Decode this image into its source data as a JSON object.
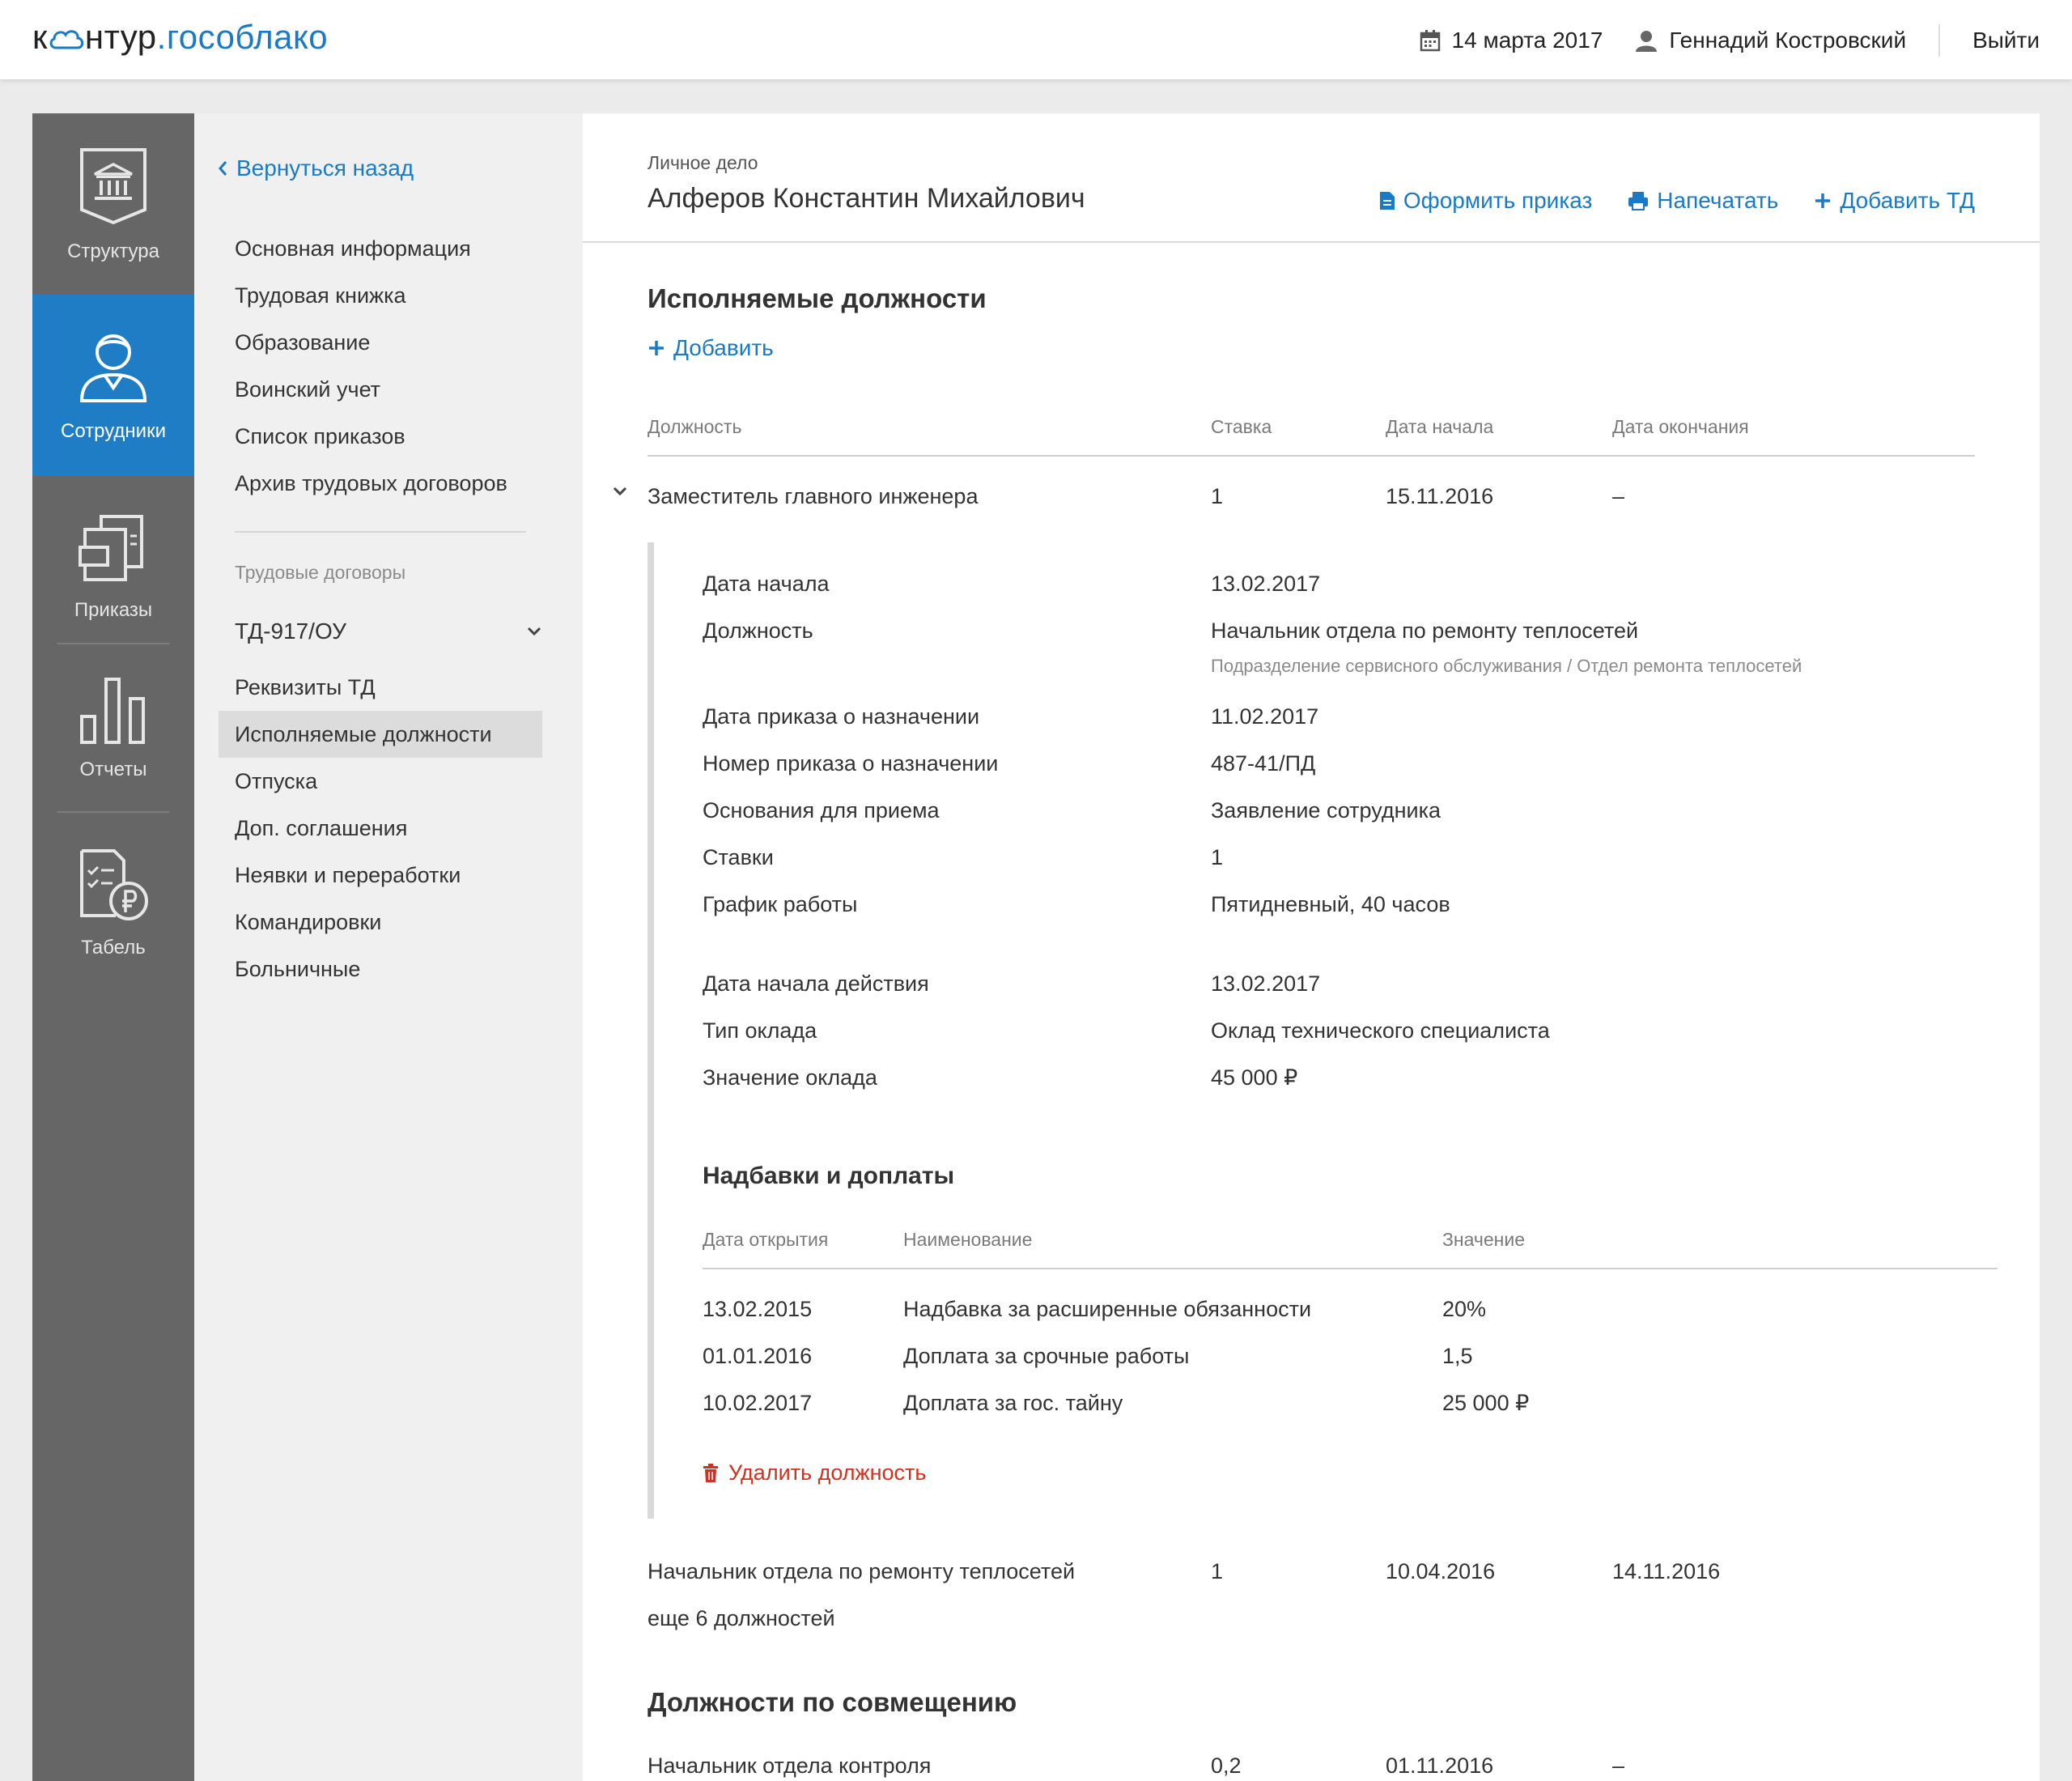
{
  "header": {
    "logo_a": "к",
    "logo_b": "нтур",
    "logo_c": ".гособлако",
    "date": "14 марта 2017",
    "user": "Геннадий Костровский",
    "logout": "Выйти"
  },
  "rail": {
    "items": [
      {
        "label": "Структура",
        "icon": "building-icon"
      },
      {
        "label": "Сотрудники",
        "icon": "employee-icon"
      },
      {
        "label": "Приказы",
        "icon": "documents-icon"
      },
      {
        "label": "Отчеты",
        "icon": "bar-chart-icon"
      },
      {
        "label": "Табель",
        "icon": "timesheet-icon"
      }
    ]
  },
  "subnav": {
    "back": "Вернуться назад",
    "links": [
      "Основная информация",
      "Трудовая книжка",
      "Образование",
      "Воинский учет",
      "Список приказов",
      "Архив трудовых договоров"
    ],
    "caption": "Трудовые договоры",
    "contract": "ТД-917/ОУ",
    "contract_links": [
      "Реквизиты ТД",
      "Исполняемые должности",
      "Отпуска",
      "Доп. соглашения",
      "Неявки и переработки",
      "Командировки",
      "Больничные"
    ]
  },
  "main": {
    "crumb": "Личное дело",
    "person": "Алферов Константин Михайлович",
    "actions": [
      "Оформить приказ",
      "Напечатать",
      "Добавить ТД"
    ],
    "section_title": "Исполняемые должности",
    "add": "Добавить",
    "columns": [
      "Должность",
      "Ставка",
      "Дата начала",
      "Дата окончания"
    ],
    "current": {
      "position": "Заместитель главного инженера",
      "rate": "1",
      "start": "15.11.2016",
      "end": "–"
    },
    "details": {
      "start_label": "Дата начала",
      "start_value": "13.02.2017",
      "position_label": "Должность",
      "position_value": "Начальник отдела по ремонту теплосетей",
      "position_note": "Подразделение сервисного обслуживания / Отдел ремонта теплосетей",
      "order_date_label": "Дата приказа о назначении",
      "order_date_value": "11.02.2017",
      "order_num_label": "Номер приказа о назначении",
      "order_num_value": "487-41/ПД",
      "basis_label": "Основания для приема",
      "basis_value": "Заявление сотрудника",
      "rates_label": "Ставки",
      "rates_value": "1",
      "schedule_label": "График работы",
      "schedule_value": "Пятидневный, 40 часов",
      "effective_label": "Дата начала действия",
      "effective_value": "13.02.2017",
      "salary_type_label": "Тип оклада",
      "salary_type_value": "Оклад технического специалиста",
      "salary_label": "Значение оклада",
      "salary_value": "45 000 ₽"
    },
    "allowances": {
      "title": "Надбавки и доплаты",
      "columns": [
        "Дата открытия",
        "Наименование",
        "Значение"
      ],
      "rows": [
        {
          "date": "13.02.2015",
          "name": "Надбавка за расширенные обязанности",
          "value": "20%"
        },
        {
          "date": "01.01.2016",
          "name": "Доплата за срочные работы",
          "value": "1,5"
        },
        {
          "date": "10.02.2017",
          "name": "Доплата за гос. тайну",
          "value": "25 000 ₽"
        }
      ]
    },
    "delete": "Удалить должность",
    "previous": {
      "position": "Начальник отдела по ремонту теплосетей",
      "rate": "1",
      "start": "10.04.2016",
      "end": "14.11.2016"
    },
    "more": "еще 6 должностей",
    "combined_title": "Должности по совмещению",
    "combined": {
      "position": "Начальник отдела контроля",
      "rate": "0,2",
      "start": "01.11.2016",
      "end": "–"
    }
  },
  "colors": {
    "accent": "#1a7ac6",
    "rail": "#666666",
    "danger": "#d0321e"
  }
}
